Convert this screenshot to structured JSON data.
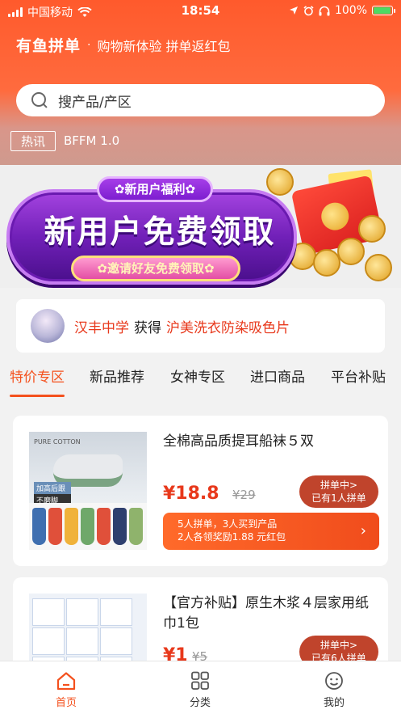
{
  "status_bar": {
    "carrier": "中国移动",
    "time": "18:54",
    "battery": "100%",
    "battery_level": 1.0
  },
  "header": {
    "brand": "有鱼拼单",
    "separator": "·",
    "slogan": "购物新体验 拼单返红包"
  },
  "search": {
    "placeholder": "搜产品/产区"
  },
  "news": {
    "tag": "热讯",
    "text": "BFFM 1.0"
  },
  "banner": {
    "top_pill": "✿新用户福利✿",
    "title": "新用户免费领取",
    "sub_pill": "✿邀请好友免费领取✿"
  },
  "winner": {
    "user": "汉丰中学",
    "action": "获得",
    "item": "沪美洗衣防染吸色片"
  },
  "tabs": [
    {
      "label": "特价专区",
      "active": true
    },
    {
      "label": "新品推荐",
      "active": false
    },
    {
      "label": "女神专区",
      "active": false
    },
    {
      "label": "进口商品",
      "active": false
    },
    {
      "label": "平台补贴",
      "active": false
    }
  ],
  "products": [
    {
      "title": "全棉高品质提耳船袜５双",
      "price": "¥18.8",
      "original_price": "¥29",
      "group_status": "拼单中>",
      "group_count": "已有1人拼单",
      "reward_line1": "5人拼单，3人买到产品",
      "reward_line2": "2人各领奖励1.88 元红包",
      "image_text_1": "PURE COTTON",
      "image_tag_1": "加高后跟",
      "image_tag_2": "不磨脚"
    },
    {
      "title": "【官方补贴】原生木浆４层家用纸巾1包",
      "price": "¥1",
      "original_price": "¥5",
      "group_status": "拼单中>",
      "group_count": "已有6人拼单"
    }
  ],
  "bottom_nav": [
    {
      "label": "首页",
      "icon": "home-icon",
      "active": true
    },
    {
      "label": "分类",
      "icon": "grid-icon",
      "active": false
    },
    {
      "label": "我的",
      "icon": "face-icon",
      "active": false
    }
  ],
  "colors": {
    "accent": "#f4511e",
    "header_top": "#ff5a2c",
    "price": "#e8381b"
  }
}
